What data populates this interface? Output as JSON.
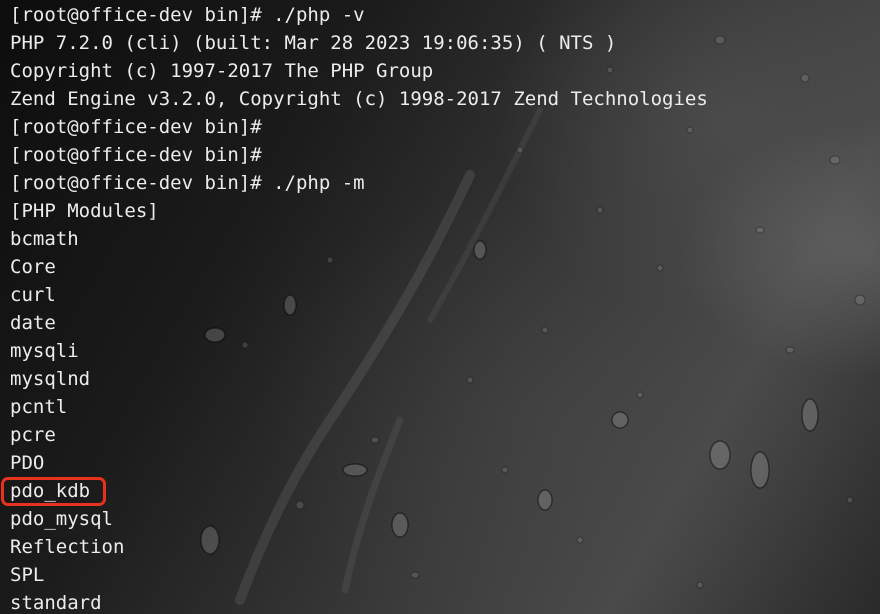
{
  "terminal": {
    "lines": [
      "[root@office-dev bin]# ./php -v",
      "PHP 7.2.0 (cli) (built: Mar 28 2023 19:06:35) ( NTS )",
      "Copyright (c) 1997-2017 The PHP Group",
      "Zend Engine v3.2.0, Copyright (c) 1998-2017 Zend Technologies",
      "[root@office-dev bin]#",
      "[root@office-dev bin]#",
      "[root@office-dev bin]# ./php -m",
      "[PHP Modules]",
      "bcmath",
      "Core",
      "curl",
      "date",
      "mysqli",
      "mysqlnd",
      "pcntl",
      "pcre",
      "PDO",
      "pdo_kdb",
      "pdo_mysql",
      "Reflection",
      "SPL",
      "standard"
    ],
    "highlighted_line": "pdo_kdb",
    "text_color": "#ececec",
    "highlight_color": "#e8321e"
  }
}
